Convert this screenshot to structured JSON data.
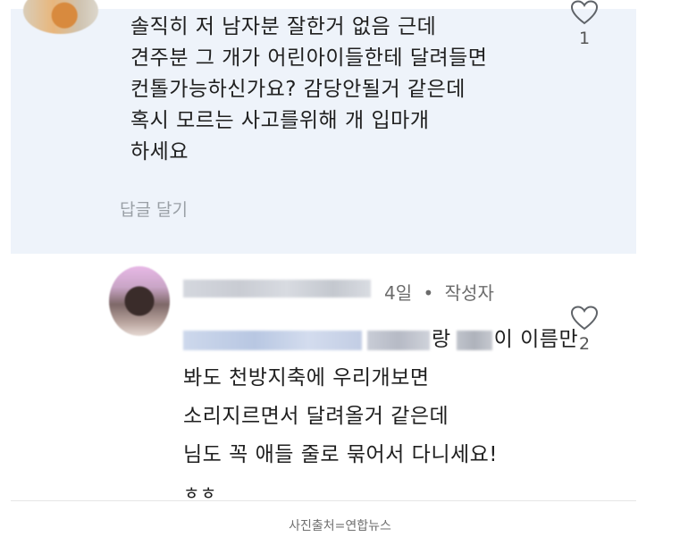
{
  "comment": {
    "lines": [
      "솔직히 저 남자분 잘한거 없음 근데",
      "견주분 그 개가 어린아이들한테 달려들면",
      "컨톨가능하신가요? 감당안될거 같은데",
      "혹시 모르는 사고를위해 개 입마개",
      "하세요"
    ],
    "reply_label": "답글 달기",
    "like_count": "1"
  },
  "reply": {
    "time": "4일",
    "separator": "•",
    "author_badge": "작성자",
    "line1_part1": "랑",
    "line1_part2": "이 이름만",
    "lines": [
      "봐도 천방지축에 우리개보면",
      "소리지르면서 달려올거 같은데",
      "님도 꼭 애들 줄로 묶어서 다니세요!",
      "ㅎㅎ"
    ],
    "like_count": "2"
  },
  "caption": "사진출처=연합뉴스"
}
